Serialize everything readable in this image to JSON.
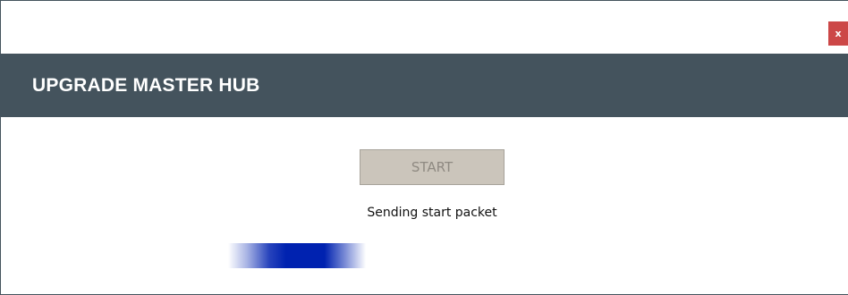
{
  "window": {
    "close_label": "x",
    "title": "UPGRADE MASTER HUB"
  },
  "main": {
    "start_label": "START",
    "start_enabled": false,
    "status": "Sending start packet"
  },
  "progress": {
    "style": "marquee-indeterminate"
  },
  "colors": {
    "header_background": "#44535d",
    "close_button": "#cc4747",
    "start_button_disabled": "#cbc5bb",
    "progress_fill": "#0022b0"
  }
}
